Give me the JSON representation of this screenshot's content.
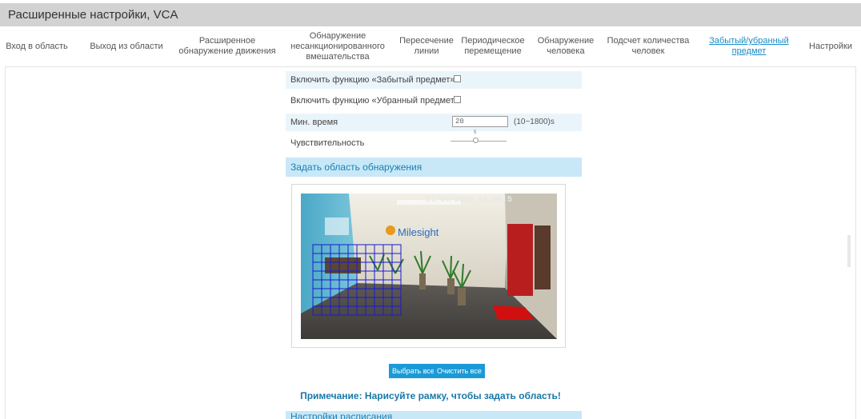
{
  "window": {
    "title": "Расширенные настройки, VCA"
  },
  "nav": {
    "items": [
      {
        "id": "entry",
        "label": "Вход в область"
      },
      {
        "id": "exit",
        "label": "Выход из области"
      },
      {
        "id": "advanced-motion",
        "label": "Расширенное обнаружение движения"
      },
      {
        "id": "tamper",
        "label": "Обнаружение несанкционированного вмешательства"
      },
      {
        "id": "line-crossing",
        "label": "Пересечение линии"
      },
      {
        "id": "loitering",
        "label": "Периодическое перемещение"
      },
      {
        "id": "human",
        "label": "Обнаружение человека"
      },
      {
        "id": "people-counting",
        "label": "Подсчет количества человек"
      },
      {
        "id": "object-left-removed",
        "label": "Забытый/убранный предмет",
        "active": true
      },
      {
        "id": "settings",
        "label": "Настройки"
      }
    ]
  },
  "form": {
    "enable_left_label": "Включить функцию «Забытый предмет»",
    "enable_left_checked": false,
    "enable_removed_label": "Включить функцию «Убранный предмет»",
    "enable_removed_checked": false,
    "min_time_label": "Мин. время",
    "min_time_value": "20",
    "min_time_range": "(10~1800)s",
    "sensitivity_label": "Чувствительность",
    "sensitivity_value": "5",
    "sensitivity_fraction": 0.5
  },
  "detection_area": {
    "header": "Задать область обнаружения",
    "timestamp": "21/04/2020 10:00:5",
    "brand": "Milesight",
    "grid_color": "#1a1ad0",
    "select_all_label": "Выбрать все",
    "clear_all_label": "Очистить все",
    "note": "Примечание: Нарисуйте рамку, чтобы задать область!"
  },
  "next_section": {
    "header": "Настройки расписания"
  }
}
